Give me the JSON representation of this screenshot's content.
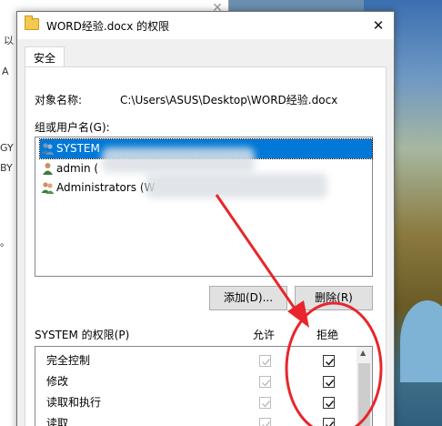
{
  "dialog": {
    "title": "WORD经验.docx 的权限",
    "close_glyph": "✕"
  },
  "tabs": [
    {
      "label": "安全"
    }
  ],
  "object": {
    "label": "对象名称:",
    "path": "C:\\Users\\ASUS\\Desktop\\WORD经验.docx"
  },
  "users": {
    "label": "组或用户名(G):",
    "items": [
      {
        "label": "SYSTEM",
        "icon": "group-icon",
        "selected": true
      },
      {
        "label": "admin (",
        "icon": "user-icon",
        "selected": false
      },
      {
        "label": "Administrators (W",
        "icon": "group-icon",
        "selected": false
      }
    ]
  },
  "buttons": {
    "add": "添加(D)...",
    "remove": "删除(R)"
  },
  "permissions": {
    "label": "SYSTEM 的权限(P)",
    "allow_header": "允许",
    "deny_header": "拒绝",
    "rows": [
      {
        "name": "完全控制",
        "allow": true,
        "allow_disabled": true,
        "deny": true
      },
      {
        "name": "修改",
        "allow": true,
        "allow_disabled": true,
        "deny": true
      },
      {
        "name": "读取和执行",
        "allow": true,
        "allow_disabled": true,
        "deny": true
      },
      {
        "name": "读取",
        "allow": true,
        "allow_disabled": true,
        "deny": true
      }
    ]
  },
  "background_window": {
    "close_glyph": "✕",
    "edge_texts": [
      "以",
      "A",
      "GY",
      "BY",
      "。"
    ]
  },
  "colors": {
    "selection": "#0078d7",
    "annotation": "#e8262b",
    "folder": "#f3c84f"
  }
}
